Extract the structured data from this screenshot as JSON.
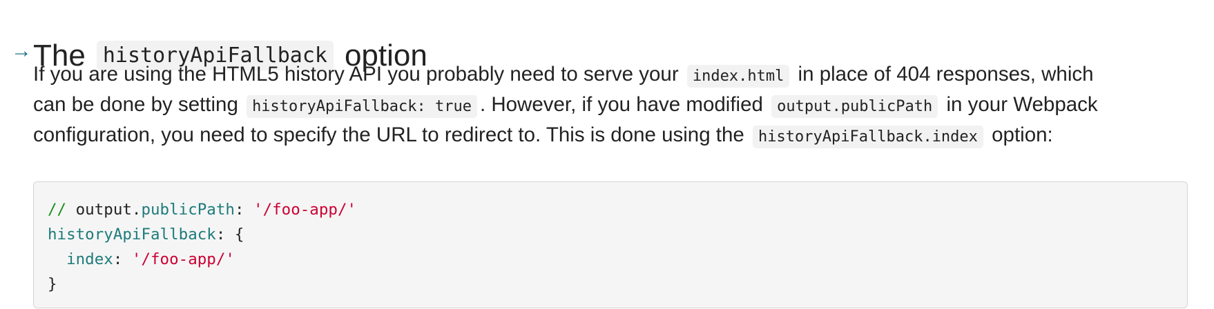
{
  "heading": {
    "anchor": "→",
    "prefix": "The",
    "code": "historyApiFallback",
    "suffix": "option"
  },
  "paragraph": {
    "l1_a": "If you are using the HTML5 history API you probably need to serve your",
    "l1_code": "index.html",
    "l1_b": "in place of 404 responses, which",
    "l2_a": "can be done by setting",
    "l2_code1": "historyApiFallback: true",
    "l2_b": ". However, if you have modified",
    "l2_code2": "output.publicPath",
    "l2_c": "in your Webpack",
    "l3_a": "configuration, you need to specify the URL to redirect to. This is done using the",
    "l3_code": "historyApiFallback.index",
    "l3_b": "option:"
  },
  "code_block": {
    "line1": {
      "comment": "//",
      "sp": " ",
      "obj": "output.",
      "prop": "publicPath",
      "colon": ": ",
      "str": "'/foo-app/'"
    },
    "line2": {
      "key": "historyApiFallback",
      "rest": ": {"
    },
    "line3": {
      "indent": "  ",
      "key": "index",
      "colon": ": ",
      "str": "'/foo-app/'"
    },
    "line4": {
      "brace": "}"
    }
  }
}
